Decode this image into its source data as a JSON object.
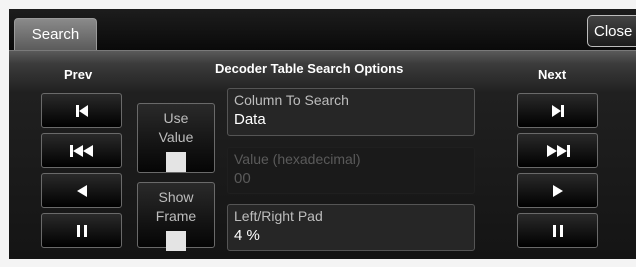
{
  "tabs": {
    "active_label": "Search"
  },
  "close_label": "Close",
  "headers": {
    "prev": "Prev",
    "next": "Next",
    "title": "Decoder Table Search Options"
  },
  "prev_buttons": [
    "skip-to-first-icon",
    "fast-rewind-icon",
    "step-back-icon",
    "pause-icon"
  ],
  "next_buttons": [
    "skip-to-last-icon",
    "fast-forward-icon",
    "step-forward-icon",
    "pause-icon"
  ],
  "toggles": {
    "use_value": {
      "line1": "Use",
      "line2": "Value",
      "checked": false
    },
    "show_frame": {
      "line1": "Show",
      "line2": "Frame",
      "checked": false
    }
  },
  "fields": {
    "column": {
      "label": "Column To Search",
      "value": "Data",
      "enabled": true
    },
    "value_hex": {
      "label": "Value (hexadecimal)",
      "value": "00",
      "enabled": false
    },
    "pad": {
      "label": "Left/Right Pad",
      "value": "4 %",
      "enabled": true
    }
  },
  "colors": {
    "background": "#000000",
    "panel_text": "#ffffff",
    "muted_text": "#bdbdbd",
    "disabled_text": "#5a5a5a",
    "checkbox": "#e4e4e4"
  }
}
